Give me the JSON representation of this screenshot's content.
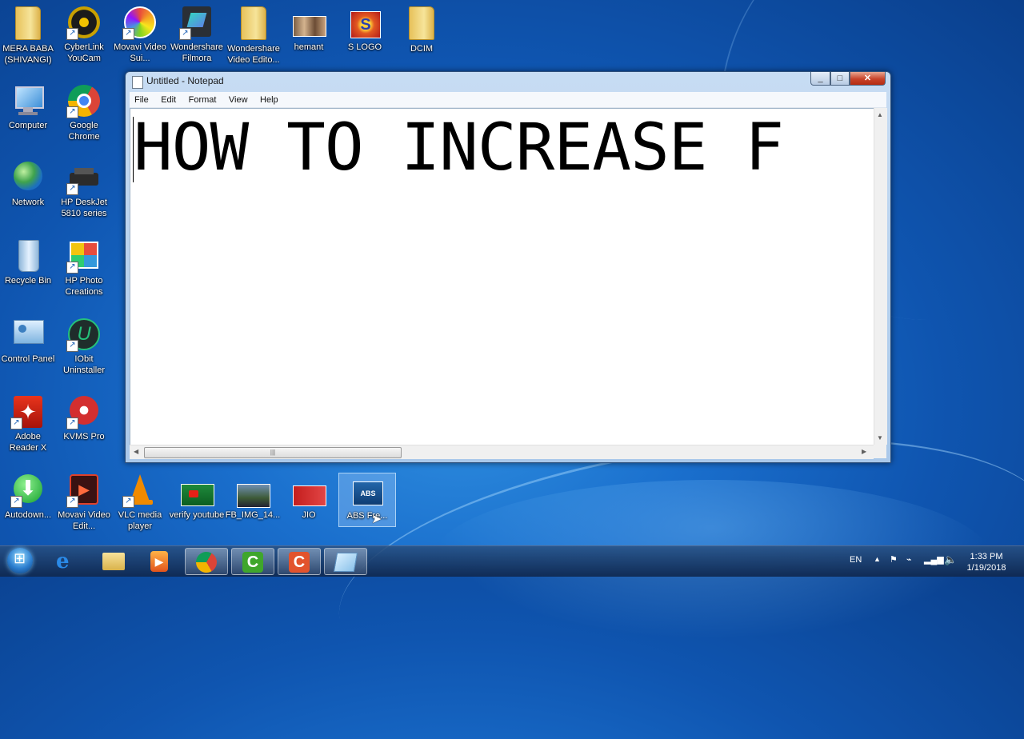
{
  "desktop": {
    "icons": [
      {
        "label": "MERA BABA (SHIVANGI)"
      },
      {
        "label": "CyberLink YouCam"
      },
      {
        "label": "Movavi Video Sui..."
      },
      {
        "label": "Wondershare Filmora"
      },
      {
        "label": "Wondershare Video Edito..."
      },
      {
        "label": "hemant"
      },
      {
        "label": "S LOGO"
      },
      {
        "label": "DCIM"
      },
      {
        "label": "Computer"
      },
      {
        "label": "Google Chrome"
      },
      {
        "label": "Network"
      },
      {
        "label": "HP DeskJet 5810 series"
      },
      {
        "label": "Recycle Bin"
      },
      {
        "label": "HP Photo Creations"
      },
      {
        "label": "Control Panel"
      },
      {
        "label": "IObit Uninstaller"
      },
      {
        "label": "Adobe Reader X"
      },
      {
        "label": "KVMS Pro"
      },
      {
        "label": "Autodown..."
      },
      {
        "label": "Movavi Video Edit..."
      },
      {
        "label": "VLC media player"
      },
      {
        "label": "verify youtube"
      },
      {
        "label": "FB_IMG_14..."
      },
      {
        "label": "JIO"
      },
      {
        "label": "ABS Fre..."
      }
    ]
  },
  "notepad": {
    "title": "Untitled - Notepad",
    "menu": [
      "File",
      "Edit",
      "Format",
      "View",
      "Help"
    ],
    "content": "HOW TO INCREASE F"
  },
  "taskbar": {
    "pinned": [
      "internet-explorer",
      "windows-explorer",
      "media-player",
      "chrome",
      "camtasia-green",
      "camtasia-orange",
      "notepad"
    ],
    "tray": {
      "language": "EN",
      "time": "1:33 PM",
      "date": "1/19/2018"
    }
  },
  "colors": {
    "desktop_bg": "#1a6fcd",
    "close_button": "#c7432a",
    "taskbar": "#1b3d66"
  }
}
